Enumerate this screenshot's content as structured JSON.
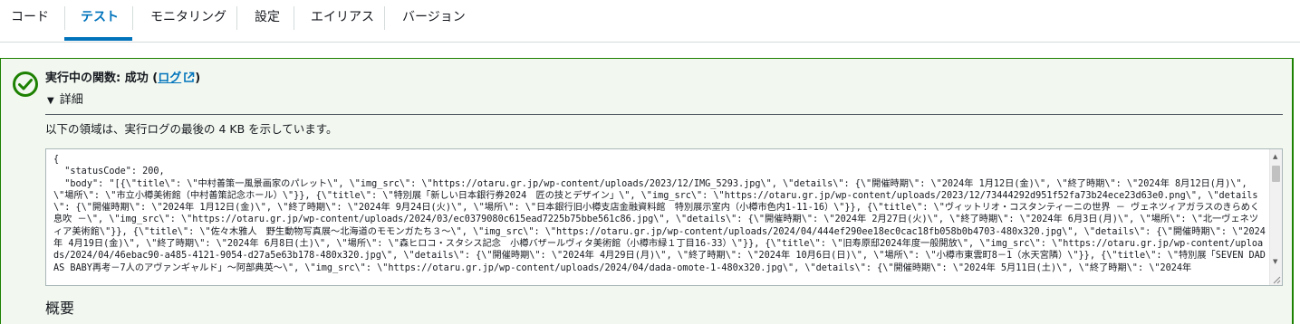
{
  "tabs": [
    {
      "label": "コード"
    },
    {
      "label": "テスト"
    },
    {
      "label": "モニタリング"
    },
    {
      "label": "設定"
    },
    {
      "label": "エイリアス"
    },
    {
      "label": "バージョン"
    }
  ],
  "active_tab": "テスト",
  "colors": {
    "accent": "#0073bb",
    "success": "#1d8102",
    "success_bg": "#f2f8f0"
  },
  "result": {
    "title_prefix": "実行中の関数: 成功 (",
    "log_link": "ログ",
    "title_suffix": ")",
    "details_label": "詳細",
    "note": "以下の領域は、実行ログの最後の 4 KB を示しています。",
    "log_output": "{\n  \"statusCode\": 200,\n  \"body\": \"[{\\\"title\\\": \\\"中村善策一風景画家のパレット\\\", \\\"img_src\\\": \\\"https://otaru.gr.jp/wp-content/uploads/2023/12/IMG_5293.jpg\\\", \\\"details\\\": {\\\"開催時期\\\": \\\"2024年 1月12日(金)\\\", \\\"終了時期\\\": \\\"2024年 8月12日(月)\\\", \\\"場所\\\": \\\"市立小樽美術館（中村善策記念ホール）\\\"}}, {\\\"title\\\": \\\"特別展「新しい日本銀行券2024　匠の技とデザイン」\\\", \\\"img_src\\\": \\\"https://otaru.gr.jp/wp-content/uploads/2023/12/73444292d951f52fa73b24ece23d63e0.png\\\", \\\"details\\\": {\\\"開催時期\\\": \\\"2024年 1月12日(金)\\\", \\\"終了時期\\\": \\\"2024年 9月24日(火)\\\", \\\"場所\\\": \\\"日本銀行旧小樽支店金融資料館　特別展示室内（小樽市色内1-11-16）\\\"}}, {\\\"title\\\": \\\"ヴィットリオ・コスタンティーニの世界 － ヴェネツィアガラスのきらめく息吹 －\\\", \\\"img_src\\\": \\\"https://otaru.gr.jp/wp-content/uploads/2024/03/ec0379080c615ead7225b75bbe561c86.jpg\\\", \\\"details\\\": {\\\"開催時期\\\": \\\"2024年 2月27日(火)\\\", \\\"終了時期\\\": \\\"2024年 6月3日(月)\\\", \\\"場所\\\": \\\"北一ヴェネツィア美術館\\\"}}, {\\\"title\\\": \\\"佐々木雅人　野生動物写真展～北海道のモモンガたち３～\\\", \\\"img_src\\\": \\\"https://otaru.gr.jp/wp-content/uploads/2024/04/444ef290ee18ec0cac18fb058b0b4703-480x320.jpg\\\", \\\"details\\\": {\\\"開催時期\\\": \\\"2024年 4月19日(金)\\\", \\\"終了時期\\\": \\\"2024年 6月8日(土)\\\", \\\"場所\\\": \\\"森ヒロコ・スタシス記念　小樽バザールヴィタ美術館（小樽市緑１丁目16-33）\\\"}}, {\\\"title\\\": \\\"旧寿原邸2024年度一般開放\\\", \\\"img_src\\\": \\\"https://otaru.gr.jp/wp-content/uploads/2024/04/46ebac90-a485-4121-9054-d27a5e63b178-480x320.jpg\\\", \\\"details\\\": {\\\"開催時期\\\": \\\"2024年 4月29日(月)\\\", \\\"終了時期\\\": \\\"2024年 10月6日(日)\\\", \\\"場所\\\": \\\"小樽市東雲町8－1（水天宮隣）\\\"}}, {\\\"title\\\": \\\"特別展「SEVEN DADAS BABY再考－7人のアヴァンギャルド」～阿部典英～\\\", \\\"img_src\\\": \\\"https://otaru.gr.jp/wp-content/uploads/2024/04/dada-omote-1-480x320.jpg\\\", \\\"details\\\": {\\\"開催時期\\\": \\\"2024年 5月11日(土)\\\", \\\"終了時期\\\": \\\"2024年"
  },
  "overview": {
    "label": "概要"
  }
}
